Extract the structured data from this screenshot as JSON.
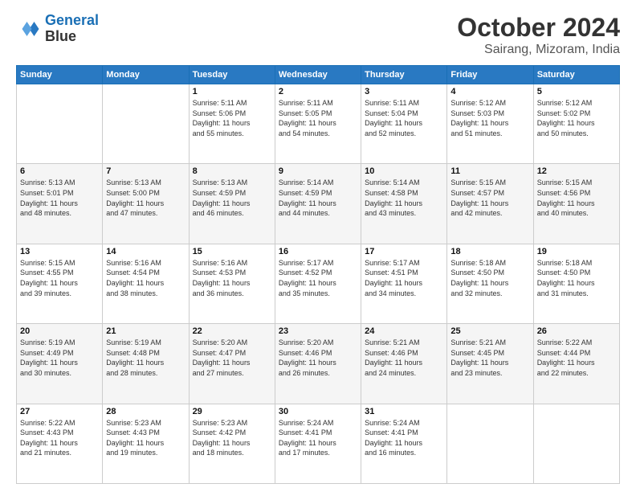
{
  "header": {
    "logo_line1": "General",
    "logo_line2": "Blue",
    "month_title": "October 2024",
    "subtitle": "Sairang, Mizoram, India"
  },
  "weekdays": [
    "Sunday",
    "Monday",
    "Tuesday",
    "Wednesday",
    "Thursday",
    "Friday",
    "Saturday"
  ],
  "weeks": [
    [
      {
        "day": "",
        "info": ""
      },
      {
        "day": "",
        "info": ""
      },
      {
        "day": "1",
        "info": "Sunrise: 5:11 AM\nSunset: 5:06 PM\nDaylight: 11 hours\nand 55 minutes."
      },
      {
        "day": "2",
        "info": "Sunrise: 5:11 AM\nSunset: 5:05 PM\nDaylight: 11 hours\nand 54 minutes."
      },
      {
        "day": "3",
        "info": "Sunrise: 5:11 AM\nSunset: 5:04 PM\nDaylight: 11 hours\nand 52 minutes."
      },
      {
        "day": "4",
        "info": "Sunrise: 5:12 AM\nSunset: 5:03 PM\nDaylight: 11 hours\nand 51 minutes."
      },
      {
        "day": "5",
        "info": "Sunrise: 5:12 AM\nSunset: 5:02 PM\nDaylight: 11 hours\nand 50 minutes."
      }
    ],
    [
      {
        "day": "6",
        "info": "Sunrise: 5:13 AM\nSunset: 5:01 PM\nDaylight: 11 hours\nand 48 minutes."
      },
      {
        "day": "7",
        "info": "Sunrise: 5:13 AM\nSunset: 5:00 PM\nDaylight: 11 hours\nand 47 minutes."
      },
      {
        "day": "8",
        "info": "Sunrise: 5:13 AM\nSunset: 4:59 PM\nDaylight: 11 hours\nand 46 minutes."
      },
      {
        "day": "9",
        "info": "Sunrise: 5:14 AM\nSunset: 4:59 PM\nDaylight: 11 hours\nand 44 minutes."
      },
      {
        "day": "10",
        "info": "Sunrise: 5:14 AM\nSunset: 4:58 PM\nDaylight: 11 hours\nand 43 minutes."
      },
      {
        "day": "11",
        "info": "Sunrise: 5:15 AM\nSunset: 4:57 PM\nDaylight: 11 hours\nand 42 minutes."
      },
      {
        "day": "12",
        "info": "Sunrise: 5:15 AM\nSunset: 4:56 PM\nDaylight: 11 hours\nand 40 minutes."
      }
    ],
    [
      {
        "day": "13",
        "info": "Sunrise: 5:15 AM\nSunset: 4:55 PM\nDaylight: 11 hours\nand 39 minutes."
      },
      {
        "day": "14",
        "info": "Sunrise: 5:16 AM\nSunset: 4:54 PM\nDaylight: 11 hours\nand 38 minutes."
      },
      {
        "day": "15",
        "info": "Sunrise: 5:16 AM\nSunset: 4:53 PM\nDaylight: 11 hours\nand 36 minutes."
      },
      {
        "day": "16",
        "info": "Sunrise: 5:17 AM\nSunset: 4:52 PM\nDaylight: 11 hours\nand 35 minutes."
      },
      {
        "day": "17",
        "info": "Sunrise: 5:17 AM\nSunset: 4:51 PM\nDaylight: 11 hours\nand 34 minutes."
      },
      {
        "day": "18",
        "info": "Sunrise: 5:18 AM\nSunset: 4:50 PM\nDaylight: 11 hours\nand 32 minutes."
      },
      {
        "day": "19",
        "info": "Sunrise: 5:18 AM\nSunset: 4:50 PM\nDaylight: 11 hours\nand 31 minutes."
      }
    ],
    [
      {
        "day": "20",
        "info": "Sunrise: 5:19 AM\nSunset: 4:49 PM\nDaylight: 11 hours\nand 30 minutes."
      },
      {
        "day": "21",
        "info": "Sunrise: 5:19 AM\nSunset: 4:48 PM\nDaylight: 11 hours\nand 28 minutes."
      },
      {
        "day": "22",
        "info": "Sunrise: 5:20 AM\nSunset: 4:47 PM\nDaylight: 11 hours\nand 27 minutes."
      },
      {
        "day": "23",
        "info": "Sunrise: 5:20 AM\nSunset: 4:46 PM\nDaylight: 11 hours\nand 26 minutes."
      },
      {
        "day": "24",
        "info": "Sunrise: 5:21 AM\nSunset: 4:46 PM\nDaylight: 11 hours\nand 24 minutes."
      },
      {
        "day": "25",
        "info": "Sunrise: 5:21 AM\nSunset: 4:45 PM\nDaylight: 11 hours\nand 23 minutes."
      },
      {
        "day": "26",
        "info": "Sunrise: 5:22 AM\nSunset: 4:44 PM\nDaylight: 11 hours\nand 22 minutes."
      }
    ],
    [
      {
        "day": "27",
        "info": "Sunrise: 5:22 AM\nSunset: 4:43 PM\nDaylight: 11 hours\nand 21 minutes."
      },
      {
        "day": "28",
        "info": "Sunrise: 5:23 AM\nSunset: 4:43 PM\nDaylight: 11 hours\nand 19 minutes."
      },
      {
        "day": "29",
        "info": "Sunrise: 5:23 AM\nSunset: 4:42 PM\nDaylight: 11 hours\nand 18 minutes."
      },
      {
        "day": "30",
        "info": "Sunrise: 5:24 AM\nSunset: 4:41 PM\nDaylight: 11 hours\nand 17 minutes."
      },
      {
        "day": "31",
        "info": "Sunrise: 5:24 AM\nSunset: 4:41 PM\nDaylight: 11 hours\nand 16 minutes."
      },
      {
        "day": "",
        "info": ""
      },
      {
        "day": "",
        "info": ""
      }
    ]
  ]
}
